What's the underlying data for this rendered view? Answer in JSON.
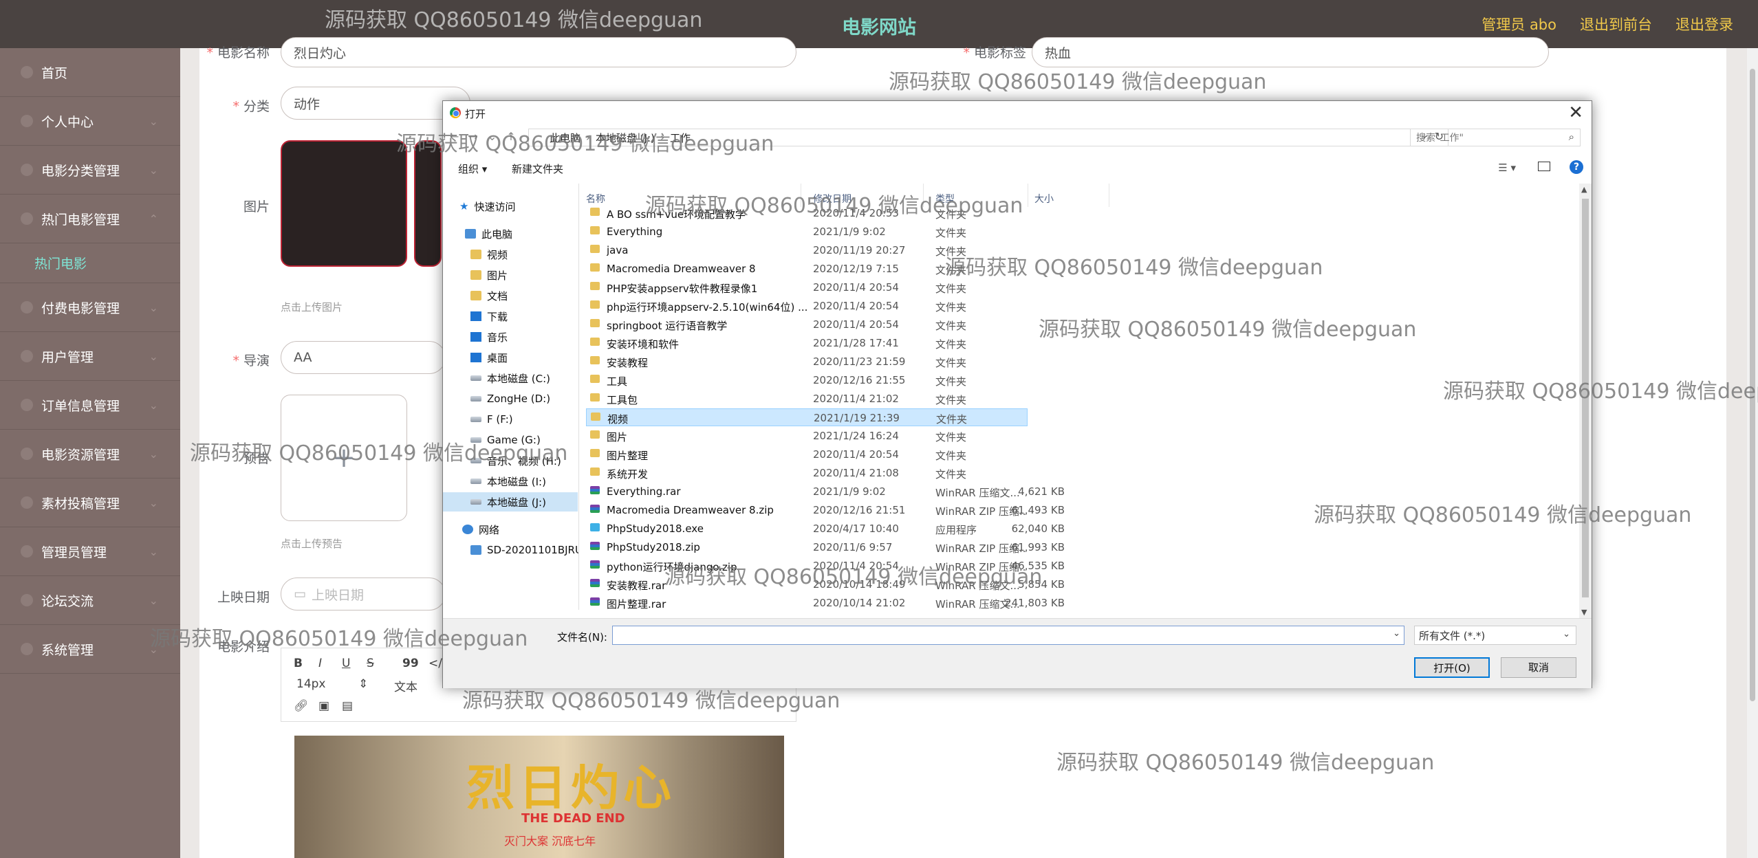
{
  "header": {
    "site_title": "电影网站",
    "admin_label": "管理员 abo",
    "back_label": "退出到前台",
    "logout_label": "退出登录"
  },
  "sidebar": {
    "items": [
      {
        "label": "首页"
      },
      {
        "label": "个人中心"
      },
      {
        "label": "电影分类管理"
      },
      {
        "label": "热门电影管理"
      },
      {
        "label": "热门电影"
      },
      {
        "label": "付费电影管理"
      },
      {
        "label": "用户管理"
      },
      {
        "label": "订单信息管理"
      },
      {
        "label": "电影资源管理"
      },
      {
        "label": "素材投稿管理"
      },
      {
        "label": "管理员管理"
      },
      {
        "label": "论坛交流"
      },
      {
        "label": "系统管理"
      }
    ]
  },
  "form": {
    "name_label": "电影名称",
    "name_value": "烈日灼心",
    "tag_label": "电影标签",
    "tag_value": "热血",
    "category_label": "分类",
    "category_value": "动作",
    "image_label": "图片",
    "image_hint": "点击上传图片",
    "director_label": "导演",
    "director_value": "AA",
    "trailer_label": "预告",
    "trailer_hint": "点击上传预告",
    "release_label": "上映日期",
    "release_placeholder": "上映日期",
    "intro_label": "电影介绍",
    "editor": {
      "bold": "B",
      "italic": "I",
      "underline": "U",
      "strike": "S",
      "quote": "99",
      "code": "</>",
      "font_size": "14px",
      "text_style": "文本",
      "poster_title": "烈日灼心",
      "poster_en": "THE DEAD END",
      "poster_line": "灭门大案 沉底七年"
    }
  },
  "dialog": {
    "title": "打开",
    "address": [
      "此电脑",
      "本地磁盘 (J:)",
      "工作"
    ],
    "search_placeholder": "搜索\"工作\"",
    "organize": "组织 ▾",
    "new_folder": "新建文件夹",
    "columns": {
      "name": "名称",
      "date": "修改日期",
      "type": "类型",
      "size": "大小"
    },
    "tree": [
      {
        "label": "快速访问",
        "icon": "star-icon"
      },
      {
        "label": "此电脑",
        "icon": "pc-icon"
      },
      {
        "label": "视频",
        "icon": "video-icon"
      },
      {
        "label": "图片",
        "icon": "picture-icon"
      },
      {
        "label": "文档",
        "icon": "document-icon"
      },
      {
        "label": "下载",
        "icon": "download-icon"
      },
      {
        "label": "音乐",
        "icon": "music-icon"
      },
      {
        "label": "桌面",
        "icon": "desktop-icon"
      },
      {
        "label": "本地磁盘 (C:)",
        "icon": "drive-icon"
      },
      {
        "label": "ZongHe (D:)",
        "icon": "drive-icon"
      },
      {
        "label": "F (F:)",
        "icon": "drive-icon"
      },
      {
        "label": "Game (G:)",
        "icon": "drive-icon"
      },
      {
        "label": "音乐、视频 (H:)",
        "icon": "drive-icon"
      },
      {
        "label": "本地磁盘 (I:)",
        "icon": "drive-icon"
      },
      {
        "label": "本地磁盘 (J:)",
        "icon": "drive-icon"
      },
      {
        "label": "网络",
        "icon": "network-icon"
      },
      {
        "label": "SD-20201101BJRU",
        "icon": "computer-icon"
      }
    ],
    "files": [
      {
        "name": "A BO ssm+vue环境配置教学",
        "date": "2020/11/4 20:53",
        "type": "文件夹",
        "size": "",
        "kind": "folder"
      },
      {
        "name": "Everything",
        "date": "2021/1/9 9:02",
        "type": "文件夹",
        "size": "",
        "kind": "folder"
      },
      {
        "name": "java",
        "date": "2020/11/19 20:27",
        "type": "文件夹",
        "size": "",
        "kind": "folder"
      },
      {
        "name": "Macromedia Dreamweaver 8",
        "date": "2020/12/19 7:15",
        "type": "文件夹",
        "size": "",
        "kind": "folder"
      },
      {
        "name": "PHP安装appserv软件教程录像1",
        "date": "2020/11/4 20:54",
        "type": "文件夹",
        "size": "",
        "kind": "folder"
      },
      {
        "name": "php运行环境appserv-2.5.10(win64位) ...",
        "date": "2020/11/4 20:54",
        "type": "文件夹",
        "size": "",
        "kind": "folder"
      },
      {
        "name": "springboot 运行语音教学",
        "date": "2020/11/4 20:54",
        "type": "文件夹",
        "size": "",
        "kind": "folder"
      },
      {
        "name": "安装环境和软件",
        "date": "2021/1/28 17:41",
        "type": "文件夹",
        "size": "",
        "kind": "folder"
      },
      {
        "name": "安装教程",
        "date": "2020/11/23 21:59",
        "type": "文件夹",
        "size": "",
        "kind": "folder"
      },
      {
        "name": "工具",
        "date": "2020/12/16 21:55",
        "type": "文件夹",
        "size": "",
        "kind": "folder"
      },
      {
        "name": "工具包",
        "date": "2020/11/4 21:02",
        "type": "文件夹",
        "size": "",
        "kind": "folder"
      },
      {
        "name": "视频",
        "date": "2021/1/19 21:39",
        "type": "文件夹",
        "size": "",
        "kind": "folder",
        "selected": true
      },
      {
        "name": "图片",
        "date": "2021/1/24 16:24",
        "type": "文件夹",
        "size": "",
        "kind": "folder"
      },
      {
        "name": "图片整理",
        "date": "2020/11/4 20:54",
        "type": "文件夹",
        "size": "",
        "kind": "folder"
      },
      {
        "name": "系统开发",
        "date": "2020/11/4 21:08",
        "type": "文件夹",
        "size": "",
        "kind": "folder"
      },
      {
        "name": "Everything.rar",
        "date": "2021/1/9 9:02",
        "type": "WinRAR 压缩文...",
        "size": "4,621 KB",
        "kind": "rar"
      },
      {
        "name": "Macromedia Dreamweaver 8.zip",
        "date": "2020/12/16 21:51",
        "type": "WinRAR ZIP 压缩...",
        "size": "61,493 KB",
        "kind": "rar"
      },
      {
        "name": "PhpStudy2018.exe",
        "date": "2020/4/17 10:40",
        "type": "应用程序",
        "size": "62,040 KB",
        "kind": "exe"
      },
      {
        "name": "PhpStudy2018.zip",
        "date": "2020/11/6 9:57",
        "type": "WinRAR ZIP 压缩...",
        "size": "61,993 KB",
        "kind": "rar"
      },
      {
        "name": "python运行环境django.zip",
        "date": "2020/11/4 20:54",
        "type": "WinRAR ZIP 压缩...",
        "size": "46,535 KB",
        "kind": "rar"
      },
      {
        "name": "安装教程.rar",
        "date": "2020/10/14 18:49",
        "type": "WinRAR 压缩文...",
        "size": "5,854 KB",
        "kind": "rar"
      },
      {
        "name": "图片整理.rar",
        "date": "2020/10/14 21:02",
        "type": "WinRAR 压缩文...",
        "size": "241,803 KB",
        "kind": "rar"
      }
    ],
    "filename_label": "文件名(N):",
    "filename_value": "",
    "filter_value": "所有文件 (*.*)",
    "open_label": "打开(O)",
    "cancel_label": "取消"
  },
  "watermark_text": "源码获取 QQ86050149 微信deepguan"
}
